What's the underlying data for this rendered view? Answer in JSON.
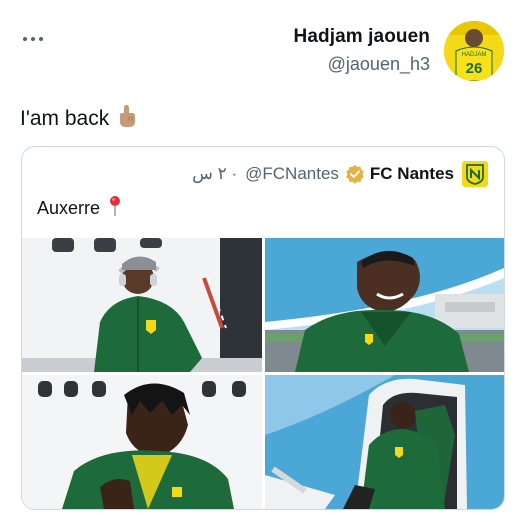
{
  "tweet": {
    "author_name": "Hadjam jaouen",
    "author_handle": "@jaouen_h3",
    "text": "I'am back",
    "avatar_jersey_number": "26",
    "avatar_jersey_name": "HADJAM"
  },
  "quoted_tweet": {
    "author_name": "FC Nantes",
    "author_handle": "@FCNantes",
    "time": "٢ س ·",
    "text": "Auxerre",
    "verified": true
  },
  "colors": {
    "brand_yellow": "#f4d916",
    "kit_green": "#1d6b3a",
    "text_primary": "#0f1419",
    "text_secondary": "#536471",
    "border": "#cfd9de"
  },
  "icons": [
    "more-icon",
    "pointing-up-emoji",
    "verified-badge-icon",
    "fc-nantes-logo",
    "round-pushpin-emoji"
  ]
}
